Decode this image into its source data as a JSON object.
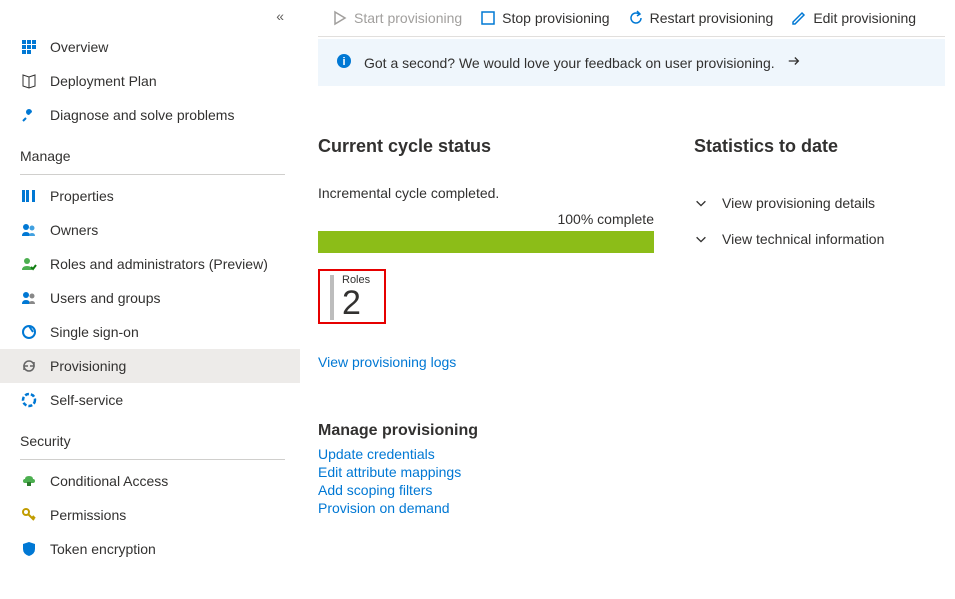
{
  "sidebar": {
    "items": [
      {
        "label": "Overview"
      },
      {
        "label": "Deployment Plan"
      },
      {
        "label": "Diagnose and solve problems"
      }
    ],
    "manage_label": "Manage",
    "manage_items": [
      {
        "label": "Properties"
      },
      {
        "label": "Owners"
      },
      {
        "label": "Roles and administrators (Preview)"
      },
      {
        "label": "Users and groups"
      },
      {
        "label": "Single sign-on"
      },
      {
        "label": "Provisioning"
      },
      {
        "label": "Self-service"
      }
    ],
    "security_label": "Security",
    "security_items": [
      {
        "label": "Conditional Access"
      },
      {
        "label": "Permissions"
      },
      {
        "label": "Token encryption"
      }
    ]
  },
  "toolbar": {
    "start": "Start provisioning",
    "stop": "Stop provisioning",
    "restart": "Restart provisioning",
    "edit": "Edit provisioning"
  },
  "feedback": {
    "text": "Got a second? We would love your feedback on user provisioning."
  },
  "cycle": {
    "title": "Current cycle status",
    "status_text": "Incremental cycle completed.",
    "progress_label": "100% complete",
    "card_label": "Roles",
    "card_value": "2",
    "view_logs": "View provisioning logs"
  },
  "stats": {
    "title": "Statistics to date",
    "details": "View provisioning details",
    "technical": "View technical information"
  },
  "manage": {
    "title": "Manage provisioning",
    "update": "Update credentials",
    "attr": "Edit attribute mappings",
    "scope": "Add scoping filters",
    "ondemand": "Provision on demand"
  }
}
